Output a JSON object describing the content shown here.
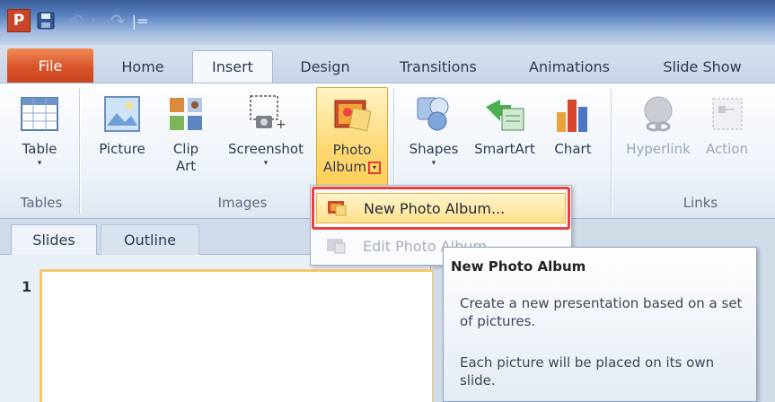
{
  "quick_access": {
    "app_letter": "P",
    "separator": "|="
  },
  "tabs": [
    {
      "label": "File"
    },
    {
      "label": "Home"
    },
    {
      "label": "Insert"
    },
    {
      "label": "Design"
    },
    {
      "label": "Transitions"
    },
    {
      "label": "Animations"
    },
    {
      "label": "Slide Show"
    }
  ],
  "ribbon": {
    "buttons": [
      {
        "label": "Table",
        "icon": "table-icon"
      },
      {
        "label": "Picture",
        "icon": "picture-icon"
      },
      {
        "label_line1": "Clip",
        "label_line2": "Art",
        "icon": "clip-art-icon"
      },
      {
        "label": "Screenshot",
        "icon": "screenshot-icon"
      },
      {
        "label_line1": "Photo",
        "label_line2": "Album",
        "icon": "photo-album-icon"
      },
      {
        "label": "Shapes",
        "icon": "shapes-icon"
      },
      {
        "label": "SmartArt",
        "icon": "smartart-icon"
      },
      {
        "label": "Chart",
        "icon": "chart-icon"
      },
      {
        "label": "Hyperlink",
        "icon": "hyperlink-icon"
      },
      {
        "label": "Action",
        "icon": "action-icon"
      }
    ],
    "groups": {
      "tables": "Tables",
      "images": "Images",
      "links": "Links"
    }
  },
  "photo_album_menu": {
    "new_item": "New Photo Album...",
    "edit_item": "Edit Photo Album..."
  },
  "pane": {
    "tabs": [
      "Slides",
      "Outline"
    ],
    "slide_number": "1"
  },
  "tooltip": {
    "title": "New Photo Album",
    "description": "Create a new presentation based on a set of pictures.",
    "detail": "Each picture will be placed on its own slide."
  },
  "colors": {
    "file_tab": "#d9542b",
    "highlight_border": "#e8403c",
    "selected_fill": "#ffd975"
  }
}
